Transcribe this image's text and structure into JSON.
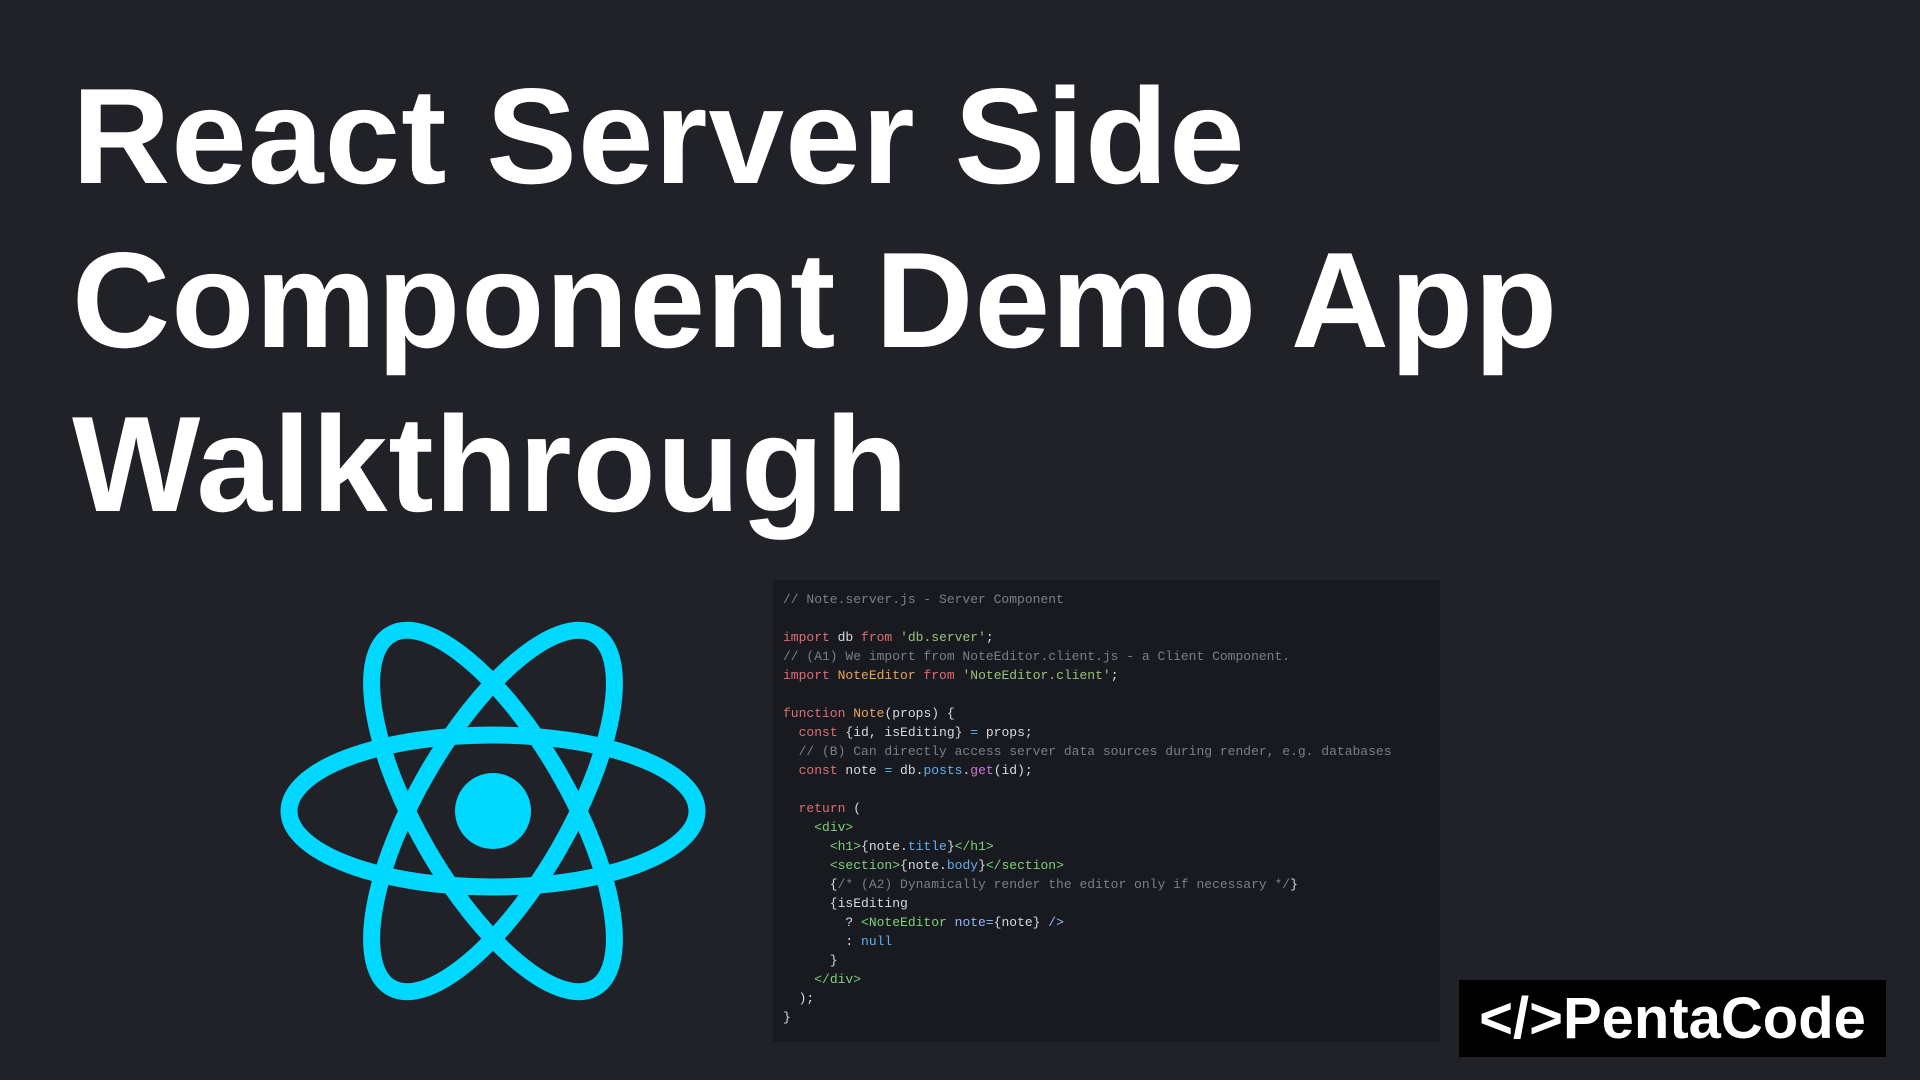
{
  "title": {
    "line1": "React Server Side",
    "line2": "Component Demo App",
    "line3": "Walkthrough"
  },
  "logo": {
    "icon": "react-atom-icon",
    "color": "#00d8ff"
  },
  "code": {
    "lines": [
      [
        {
          "t": "// Note.server.js - Server Component",
          "c": "comment"
        }
      ],
      [],
      [
        {
          "t": "import",
          "c": "keyword"
        },
        {
          "t": " db ",
          "c": "plain"
        },
        {
          "t": "from",
          "c": "keyword"
        },
        {
          "t": " ",
          "c": "plain"
        },
        {
          "t": "'db.server'",
          "c": "string"
        },
        {
          "t": ";",
          "c": "plain"
        }
      ],
      [
        {
          "t": "// (A1) We import from NoteEditor.client.js - a Client Component.",
          "c": "comment"
        }
      ],
      [
        {
          "t": "import",
          "c": "keyword"
        },
        {
          "t": " ",
          "c": "plain"
        },
        {
          "t": "NoteEditor",
          "c": "func"
        },
        {
          "t": " ",
          "c": "plain"
        },
        {
          "t": "from",
          "c": "keyword"
        },
        {
          "t": " ",
          "c": "plain"
        },
        {
          "t": "'NoteEditor.client'",
          "c": "string"
        },
        {
          "t": ";",
          "c": "plain"
        }
      ],
      [],
      [
        {
          "t": "function",
          "c": "keyword"
        },
        {
          "t": " ",
          "c": "plain"
        },
        {
          "t": "Note",
          "c": "func"
        },
        {
          "t": "(props) {",
          "c": "plain"
        }
      ],
      [
        {
          "t": "  ",
          "c": "plain"
        },
        {
          "t": "const",
          "c": "keyword"
        },
        {
          "t": " {id, isEditing} ",
          "c": "plain"
        },
        {
          "t": "=",
          "c": "prop"
        },
        {
          "t": " props;",
          "c": "plain"
        }
      ],
      [
        {
          "t": "  // (B) Can directly access server data sources during render, e.g. databases",
          "c": "comment"
        }
      ],
      [
        {
          "t": "  ",
          "c": "plain"
        },
        {
          "t": "const",
          "c": "keyword"
        },
        {
          "t": " note ",
          "c": "plain"
        },
        {
          "t": "=",
          "c": "prop"
        },
        {
          "t": " db.",
          "c": "plain"
        },
        {
          "t": "posts",
          "c": "prop"
        },
        {
          "t": ".",
          "c": "plain"
        },
        {
          "t": "get",
          "c": "method"
        },
        {
          "t": "(id);",
          "c": "plain"
        }
      ],
      [],
      [
        {
          "t": "  ",
          "c": "plain"
        },
        {
          "t": "return",
          "c": "keyword"
        },
        {
          "t": " (",
          "c": "plain"
        }
      ],
      [
        {
          "t": "    ",
          "c": "plain"
        },
        {
          "t": "<div>",
          "c": "tag"
        }
      ],
      [
        {
          "t": "      ",
          "c": "plain"
        },
        {
          "t": "<h1>",
          "c": "tag"
        },
        {
          "t": "{note.",
          "c": "plain"
        },
        {
          "t": "title",
          "c": "prop"
        },
        {
          "t": "}",
          "c": "plain"
        },
        {
          "t": "</h1>",
          "c": "tag"
        }
      ],
      [
        {
          "t": "      ",
          "c": "plain"
        },
        {
          "t": "<section>",
          "c": "tag"
        },
        {
          "t": "{note.",
          "c": "plain"
        },
        {
          "t": "body",
          "c": "prop"
        },
        {
          "t": "}",
          "c": "plain"
        },
        {
          "t": "</section>",
          "c": "tag"
        }
      ],
      [
        {
          "t": "      {",
          "c": "plain"
        },
        {
          "t": "/* (A2) Dynamically render the editor only if necessary */",
          "c": "comment"
        },
        {
          "t": "}",
          "c": "plain"
        }
      ],
      [
        {
          "t": "      {isEditing",
          "c": "plain"
        }
      ],
      [
        {
          "t": "        ? ",
          "c": "plain"
        },
        {
          "t": "<NoteEditor",
          "c": "tag"
        },
        {
          "t": " ",
          "c": "plain"
        },
        {
          "t": "note=",
          "c": "attr"
        },
        {
          "t": "{note}",
          "c": "plain"
        },
        {
          "t": " />",
          "c": "attr"
        }
      ],
      [
        {
          "t": "        : ",
          "c": "plain"
        },
        {
          "t": "null",
          "c": "prop"
        }
      ],
      [
        {
          "t": "      }",
          "c": "plain"
        }
      ],
      [
        {
          "t": "    ",
          "c": "plain"
        },
        {
          "t": "</div>",
          "c": "tag"
        }
      ],
      [
        {
          "t": "  );",
          "c": "plain"
        }
      ],
      [
        {
          "t": "}",
          "c": "plain"
        }
      ]
    ]
  },
  "brand": {
    "text": "</>PentaCode"
  }
}
